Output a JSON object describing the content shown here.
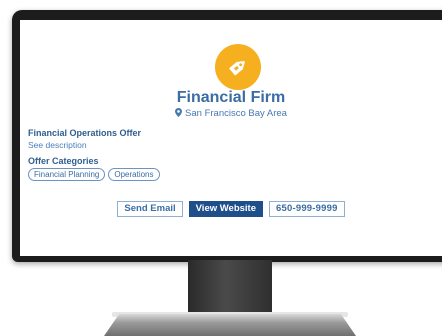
{
  "listing": {
    "company_name": "Financial Firm",
    "location": "San Francisco Bay Area",
    "offer_title": "Financial Operations Offer",
    "see_description": "See description",
    "categories_title": "Offer Categories",
    "categories": [
      "Financial Planning",
      "Operations"
    ]
  },
  "actions": {
    "send_email": "Send Email",
    "view_website": "View Website",
    "phone": "650-999-9999"
  },
  "icons": {
    "logo": "price-tag-icon",
    "location": "map-pin-icon"
  },
  "colors": {
    "logo_bg": "#f6b01f",
    "brand_blue": "#3a6da3",
    "primary_button": "#1f4f8a"
  }
}
